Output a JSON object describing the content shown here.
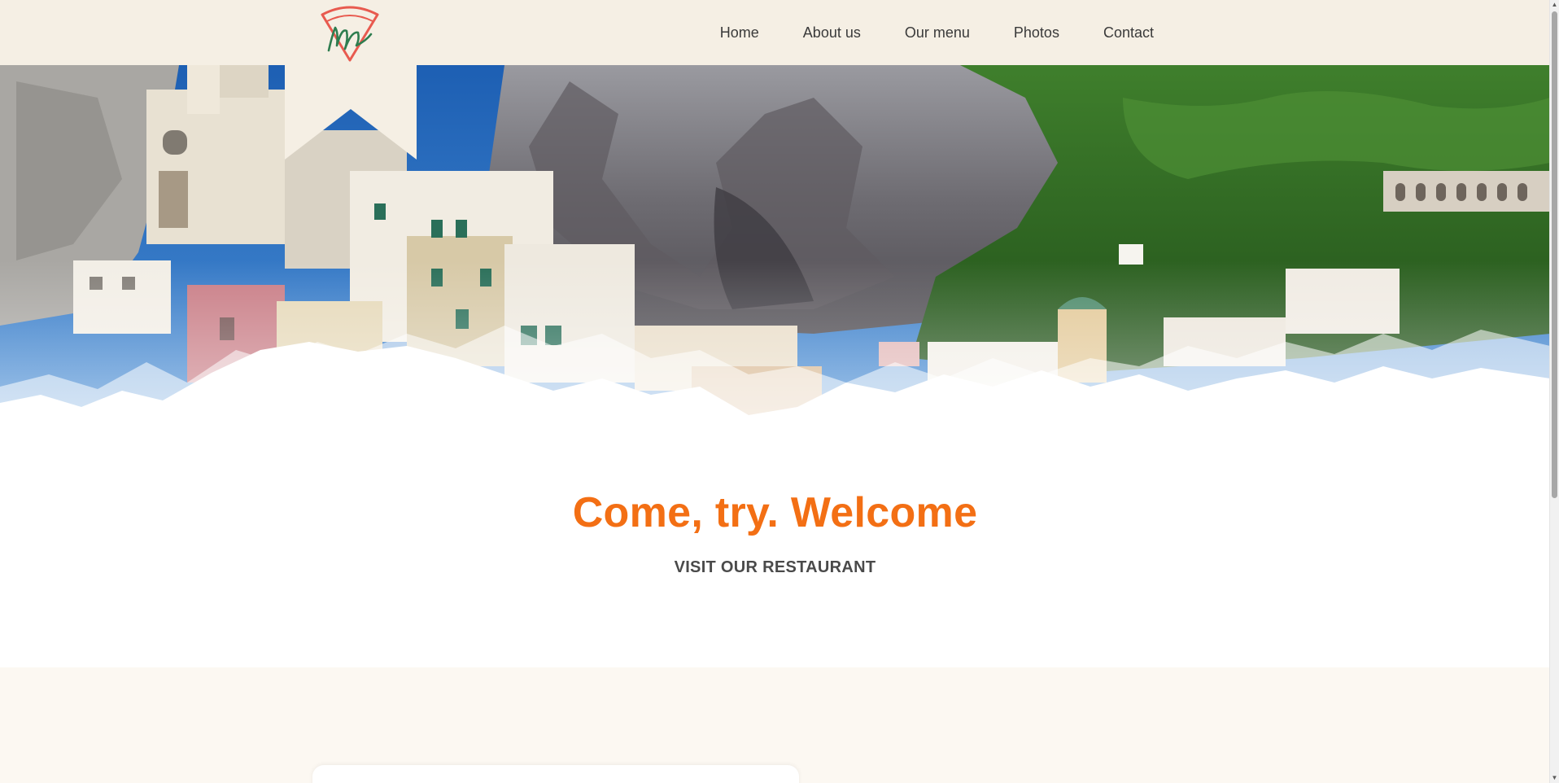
{
  "header": {
    "nav": [
      {
        "label": "Home"
      },
      {
        "label": "About us"
      },
      {
        "label": "Our menu"
      },
      {
        "label": "Photos"
      },
      {
        "label": "Contact"
      }
    ]
  },
  "hero": {
    "icon": "amalfi-coast-photo"
  },
  "welcome": {
    "title": "Come, try. Welcome",
    "subtitle": "VISIT OUR RESTAURANT"
  },
  "colors": {
    "header_bg": "#f5efe4",
    "accent": "#f36f14",
    "logo_red": "#e85a4f",
    "logo_green": "#2e7d4f",
    "section_bg": "#fcf8f2"
  },
  "icons": {
    "logo": "pizza-slice-m-logo",
    "scroll_up": "chevron-up-icon",
    "scroll_down": "chevron-down-icon"
  }
}
